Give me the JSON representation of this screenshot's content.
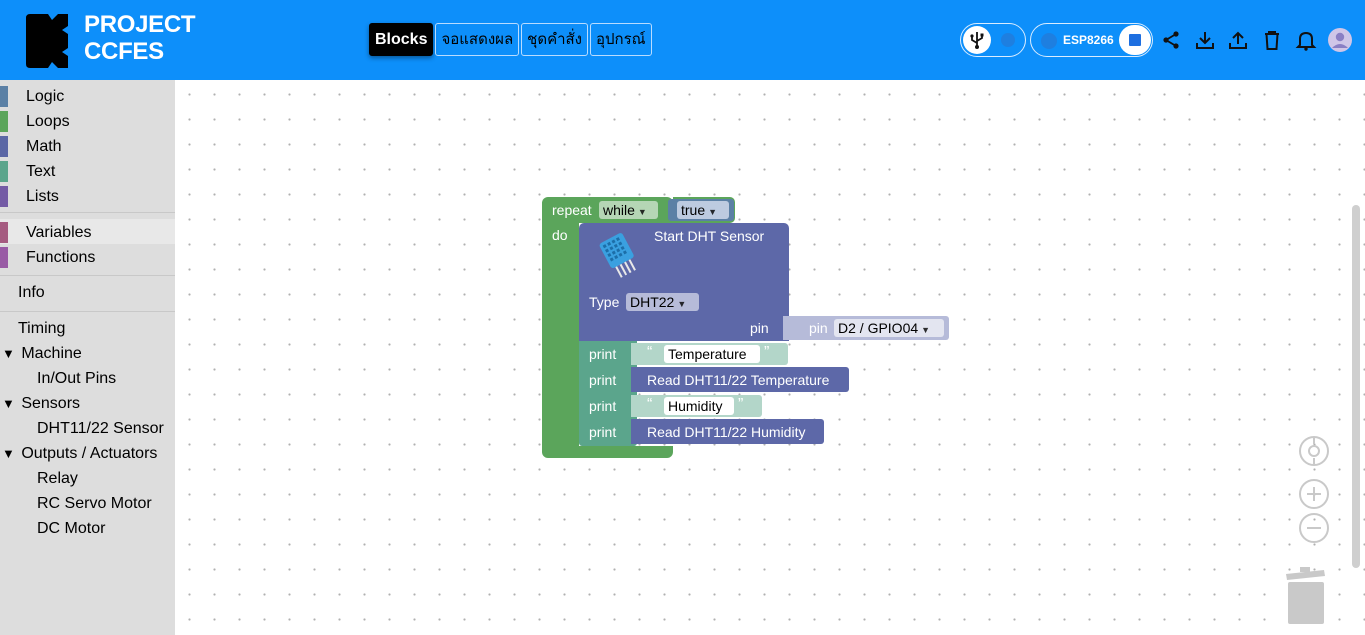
{
  "header": {
    "brand_line1": "PROJECT",
    "brand_line2": "CCFES",
    "tabs": [
      {
        "label": "Blocks",
        "active": true
      },
      {
        "label": "จอแสดงผล",
        "active": false
      },
      {
        "label": "ชุดคำสั่ง",
        "active": false
      },
      {
        "label": "อุปกรณ์",
        "active": false
      }
    ],
    "board_label": "ESP8266",
    "icons": [
      "usb-icon",
      "share-icon",
      "download-icon",
      "upload-icon",
      "trash-icon",
      "bell-icon",
      "user-avatar-icon"
    ],
    "bg_color": "#0d8ffa"
  },
  "sidebar": {
    "categories": [
      {
        "label": "Logic",
        "color": "#5b80a5"
      },
      {
        "label": "Loops",
        "color": "#5ba55b"
      },
      {
        "label": "Math",
        "color": "#5b67a5"
      },
      {
        "label": "Text",
        "color": "#5ba58c"
      },
      {
        "label": "Lists",
        "color": "#745ba5"
      },
      {
        "label": "Variables",
        "color": "#a55b80"
      },
      {
        "label": "Functions",
        "color": "#995ba5"
      }
    ],
    "info": "Info",
    "timing": "Timing",
    "groups": [
      {
        "label": "Machine",
        "children": [
          "In/Out Pins"
        ]
      },
      {
        "label": "Sensors",
        "children": [
          "DHT11/22 Sensor"
        ]
      },
      {
        "label": "Outputs / Actuators",
        "children": [
          "Relay",
          "RC Servo Motor",
          "DC Motor"
        ]
      }
    ],
    "expand_glyph": "▼"
  },
  "blocks": {
    "repeat": "repeat",
    "while": "while",
    "true": "true",
    "do": "do",
    "start_dht": "Start DHT Sensor",
    "type_label": "Type",
    "type_value": "DHT22",
    "pin_label": "pin",
    "pin_inner_label": "pin",
    "pin_value": "D2 / GPIO04",
    "print": "print",
    "str_temperature": "Temperature",
    "read_temp": "Read DHT11/22 Temperature",
    "str_humidity": "Humidity",
    "read_humid": "Read DHT11/22 Humidity",
    "open_quote": "“",
    "close_quote": "”",
    "dropdown_arrow": "▼"
  }
}
